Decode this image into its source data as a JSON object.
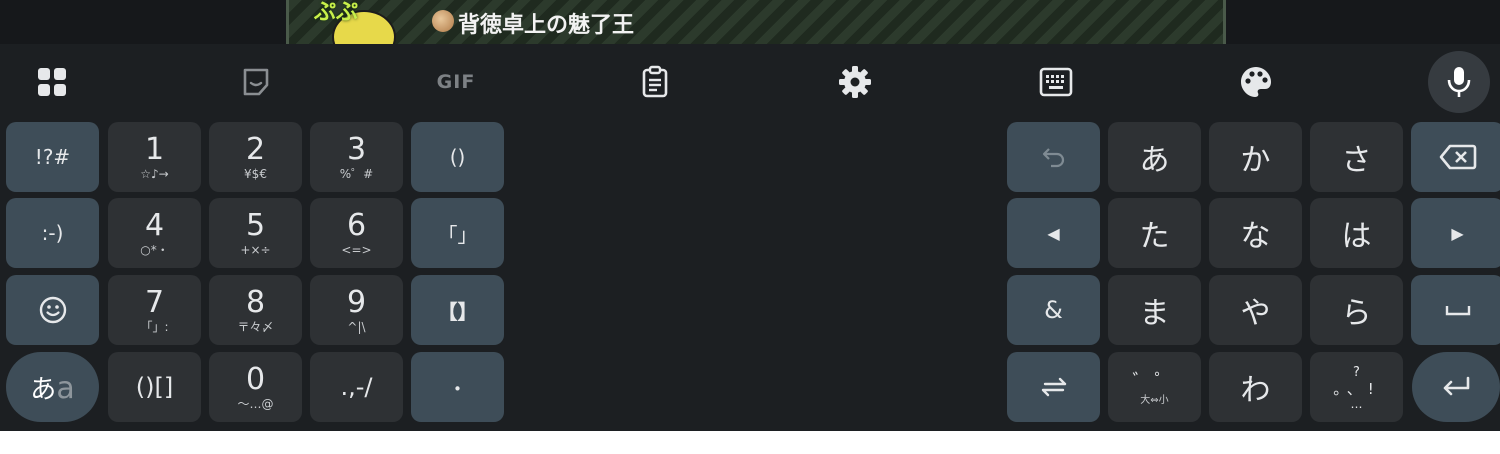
{
  "banner": {
    "title": "背徳卓上の魅了王",
    "sticker_text": "ぷぷ"
  },
  "toolbar": {
    "icons": [
      "apps-grid-icon",
      "sticker-icon",
      "gif-icon",
      "clipboard-icon",
      "settings-gear-icon",
      "keyboard-icon",
      "theme-palette-icon",
      "microphone-icon"
    ],
    "gif_label": "GIF"
  },
  "left_pad": {
    "symbols_key": "!?#",
    "emoticon_key": ":-)",
    "emoji_icon": "smiley-face-icon",
    "ime_main": "あ",
    "ime_alt": "a",
    "k1": {
      "main": "1",
      "sub": "☆♪→"
    },
    "k2": {
      "main": "2",
      "sub": "¥$€"
    },
    "k3": {
      "main": "3",
      "sub": "%゜#"
    },
    "k4": {
      "main": "4",
      "sub": "○*・"
    },
    "k5": {
      "main": "5",
      "sub": "+×÷"
    },
    "k6": {
      "main": "6",
      "sub": "<=>"
    },
    "k7": {
      "main": "7",
      "sub": "「」:"
    },
    "k8": {
      "main": "8",
      "sub": "〒々〆"
    },
    "k9": {
      "main": "9",
      "sub": "^|\\"
    },
    "brackets_key": "()[]",
    "k0": {
      "main": "0",
      "sub": "〜…@"
    },
    "punct_key": ".,-/",
    "paren_key": "()",
    "kagi_key": "「」",
    "sumitsuki_key": "【】",
    "dot_key": "・"
  },
  "right_pad": {
    "undo_icon": "undo-icon",
    "left_arrow": "◀",
    "ampersand": "&",
    "swap_icon": "swap-arrows-icon",
    "a": "あ",
    "ka": "か",
    "sa": "さ",
    "ta": "た",
    "na": "な",
    "ha": "は",
    "ma": "ま",
    "ya": "や",
    "ra": "ら",
    "dakuten_top": "゛゜",
    "dakuten_bottom": "大⇔小",
    "wa": "わ",
    "punct_q": "?",
    "punct_mid": "。、!",
    "punct_dots": "…",
    "backspace_icon": "backspace-icon",
    "right_arrow": "▶",
    "space_symbol": "␣",
    "enter_icon": "enter-return-icon"
  }
}
